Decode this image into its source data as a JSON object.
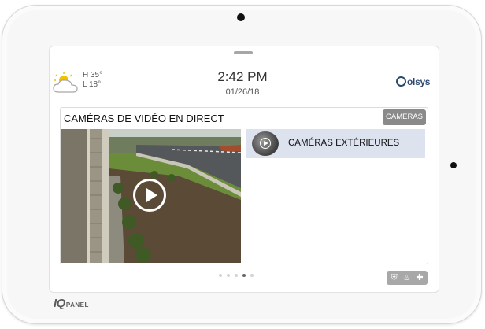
{
  "device": {
    "brand_main": "IQ",
    "brand_sub": "PANEL"
  },
  "header": {
    "weather": {
      "icon": "sun-cloud-icon",
      "high": "H 35°",
      "low": "L 18°"
    },
    "time": "2:42 PM",
    "date": "01/26/18",
    "logo": "olsys",
    "logo_icon": "qolsys-q-icon"
  },
  "card": {
    "title": "CAMÉRAS DE VIDÉO EN DIRECT",
    "cameras_button": "CAMÉRAS",
    "video": {
      "play_icon": "play-circle-icon"
    },
    "cameras": [
      {
        "label": "CAMÉRAS EXTÉRIEURES",
        "thumb_icon": "camera-thumbnail-icon"
      }
    ]
  },
  "pager": {
    "count": 5,
    "active_index": 3
  },
  "status_icons": [
    {
      "name": "shield-icon",
      "glyph": "⛨"
    },
    {
      "name": "flame-icon",
      "glyph": "♨"
    },
    {
      "name": "medical-cross-icon",
      "glyph": "✚"
    }
  ],
  "colors": {
    "highlight": "#dde2ef",
    "button_gray": "#8a8a8a",
    "logo_blue": "#2d4a6e"
  }
}
